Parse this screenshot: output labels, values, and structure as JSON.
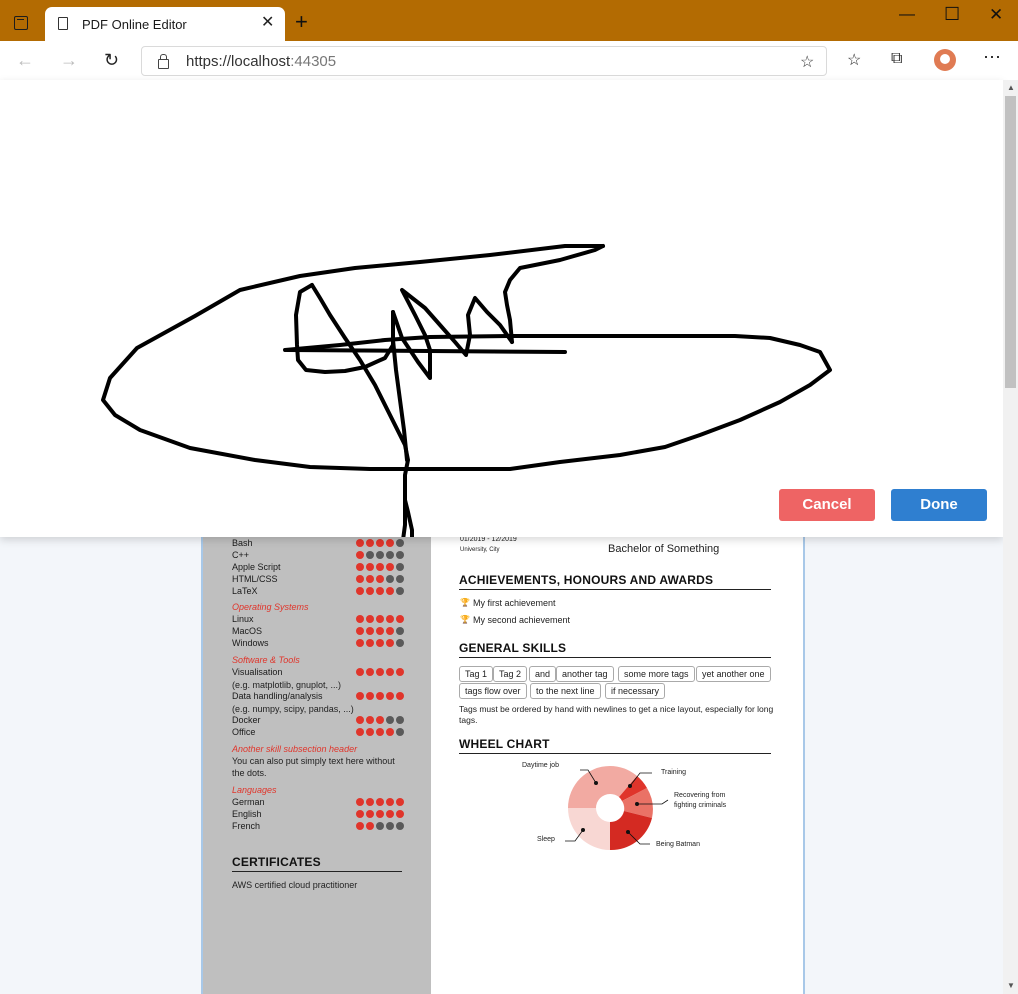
{
  "browser": {
    "tab_title": "PDF Online Editor",
    "url_host": "https://localhost",
    "url_port": ":44305"
  },
  "modal": {
    "cancel_label": "Cancel",
    "done_label": "Done"
  },
  "sidebar": {
    "rows_top": [
      {
        "label": "Bash",
        "level": 4
      },
      {
        "label": "C++",
        "level": 1
      },
      {
        "label": "Apple Script",
        "level": 4
      },
      {
        "label": "HTML/CSS",
        "level": 3
      },
      {
        "label": "LaTeX",
        "level": 4
      }
    ],
    "os_header": "Operating Systems",
    "os_rows": [
      {
        "label": "Linux",
        "level": 5
      },
      {
        "label": "MacOS",
        "level": 4
      },
      {
        "label": "Windows",
        "level": 4
      }
    ],
    "tools_header": "Software & Tools",
    "vis_label": "Visualisation",
    "vis_note": "(e.g. matplotlib, gnuplot, ...)",
    "data_label": "Data handling/analysis",
    "data_note": "(e.g. numpy, scipy, pandas, ...)",
    "docker_label": "Docker",
    "office_label": "Office",
    "another_header": "Another skill subsection header",
    "another_text": "You can also put simply text here without the dots.",
    "lang_header": "Languages",
    "lang_rows": [
      {
        "label": "German",
        "level": 5
      },
      {
        "label": "English",
        "level": 5
      },
      {
        "label": "French",
        "level": 2
      }
    ],
    "certificates_title": "CERTIFICATES",
    "certificate_item": "AWS certified cloud practitioner"
  },
  "main": {
    "edu_dates": "01/2019 - 12/2019",
    "edu_location": "University, City",
    "edu_degree": "Bachelor of Something",
    "achievements_title": "ACHIEVEMENTS, HONOURS AND AWARDS",
    "achievement_1": "My first achievement",
    "achievement_2": "My second achievement",
    "skills_title": "GENERAL SKILLS",
    "tags_row1": [
      "Tag 1",
      "Tag 2",
      "and",
      "another tag",
      "some more tags",
      "yet another one"
    ],
    "tags_row2": [
      "tags flow over",
      "to the next line",
      "if necessary"
    ],
    "tags_note": "Tags must be ordered by hand with newlines to get a nice layout, especially for long tags.",
    "wheel_title": "WHEEL CHART",
    "wheel_labels": {
      "daytime": "Daytime job",
      "training": "Training",
      "recovering_1": "Recovering from",
      "recovering_2": "fighting criminals",
      "sleep": "Sleep",
      "batman": "Being Batman"
    }
  },
  "colors": {
    "dot_on": "#e0352b",
    "dot_off": "#5a5a5a",
    "accent": "#e0352b"
  }
}
